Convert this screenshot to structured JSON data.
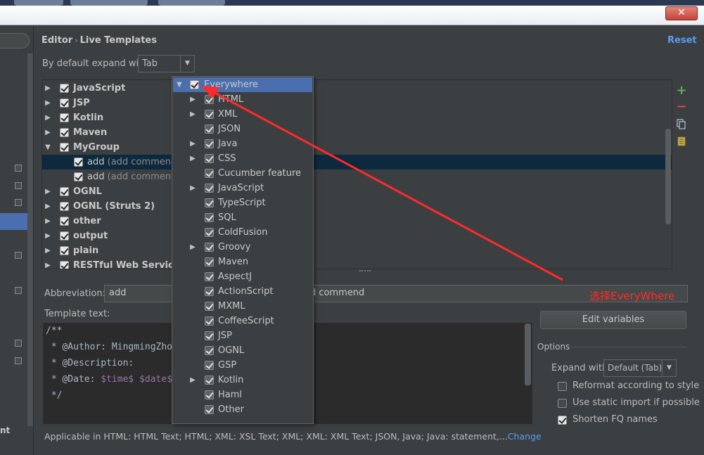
{
  "window": {
    "close_glyph": "✕"
  },
  "left_nav": {
    "partial_text": "nt"
  },
  "header": {
    "breadcrumb_parent": "Editor",
    "breadcrumb_separator": "›",
    "breadcrumb_current": "Live Templates",
    "reset_label": "Reset"
  },
  "expand": {
    "label": "By default expand with",
    "value": "Tab"
  },
  "tree": {
    "groups": [
      {
        "label": "JavaScript"
      },
      {
        "label": "JSP"
      },
      {
        "label": "Kotlin"
      },
      {
        "label": "Maven"
      },
      {
        "label": "MyGroup"
      },
      {
        "label": "OGNL"
      },
      {
        "label": "OGNL (Struts 2)"
      },
      {
        "label": "other"
      },
      {
        "label": "output"
      },
      {
        "label": "plain"
      },
      {
        "label": "RESTful Web Services"
      }
    ],
    "templates": [
      {
        "label": "add",
        "desc": "(add commend)"
      },
      {
        "label": "add",
        "desc": "(add comment)"
      }
    ]
  },
  "toolbar": {
    "add_icon": "plus-icon",
    "remove_icon": "minus-icon",
    "copy_icon": "copy-icon",
    "notes_icon": "notes-icon"
  },
  "abbreviation": {
    "label": "Abbreviation:",
    "value": "add",
    "description_value": "d commend"
  },
  "template_text": {
    "label": "Template text:",
    "lines": [
      "/**",
      " * @Author: MingmingZho",
      " * @Description:",
      " * @Date: ",
      " */"
    ],
    "date_vars": "$time$ $date$"
  },
  "edit_variables_label": "Edit variables",
  "options": {
    "title": "Options",
    "expand_label": "Expand with",
    "expand_value": "Default (Tab)",
    "checks": [
      {
        "label": "Reformat according to style",
        "checked": false
      },
      {
        "label": "Use static import if possible",
        "checked": false
      },
      {
        "label": "Shorten FQ names",
        "checked": true
      }
    ]
  },
  "applicable": {
    "text": "Applicable in HTML: HTML Text; HTML; XML: XSL Text; XML; XML: XML Text; JSON, Java; Java: statement,...",
    "change_label": "Change"
  },
  "context_popup": {
    "root": "Everywhere",
    "items": [
      {
        "label": "HTML",
        "expandable": true
      },
      {
        "label": "XML",
        "expandable": true
      },
      {
        "label": "JSON",
        "expandable": false
      },
      {
        "label": "Java",
        "expandable": true
      },
      {
        "label": "CSS",
        "expandable": true
      },
      {
        "label": "Cucumber feature",
        "expandable": false
      },
      {
        "label": "JavaScript",
        "expandable": true
      },
      {
        "label": "TypeScript",
        "expandable": false
      },
      {
        "label": "SQL",
        "expandable": false
      },
      {
        "label": "ColdFusion",
        "expandable": false
      },
      {
        "label": "Groovy",
        "expandable": true
      },
      {
        "label": "Maven",
        "expandable": false
      },
      {
        "label": "AspectJ",
        "expandable": false
      },
      {
        "label": "ActionScript",
        "expandable": false
      },
      {
        "label": "MXML",
        "expandable": false
      },
      {
        "label": "CoffeeScript",
        "expandable": false
      },
      {
        "label": "JSP",
        "expandable": false
      },
      {
        "label": "OGNL",
        "expandable": false
      },
      {
        "label": "GSP",
        "expandable": false
      },
      {
        "label": "Kotlin",
        "expandable": true
      },
      {
        "label": "Haml",
        "expandable": false
      },
      {
        "label": "Other",
        "expandable": false
      }
    ]
  },
  "annotation": {
    "text": "选择EveryWhere",
    "color": "#ff2a2a"
  },
  "colors": {
    "selection": "#4b6eaf",
    "link": "#589df6",
    "background": "#3c3f41"
  }
}
